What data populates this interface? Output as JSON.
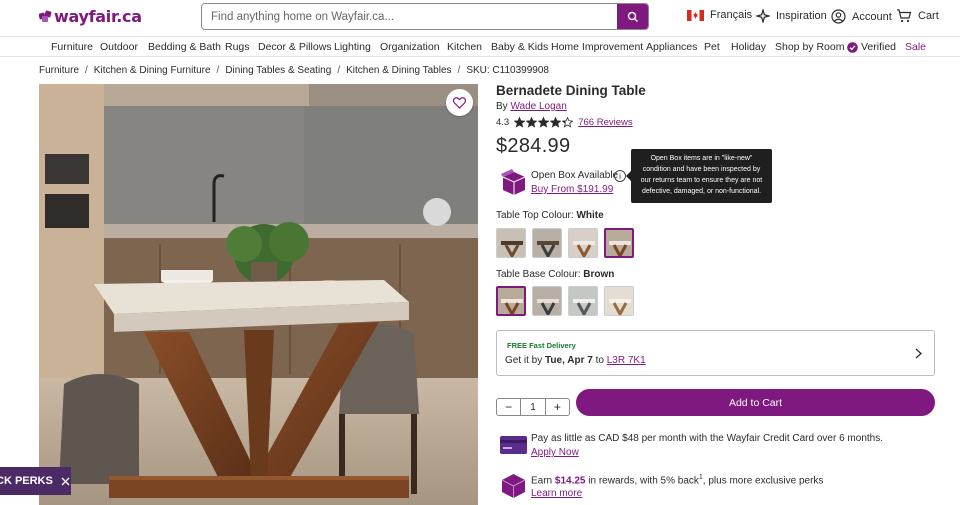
{
  "brand": {
    "logo_text": "wayfair.ca",
    "accent": "#7f187f"
  },
  "search": {
    "placeholder": "Find anything home on Wayfair.ca..."
  },
  "header_links": {
    "language": "Français",
    "inspiration": "Inspiration",
    "account": "Account",
    "cart": "Cart"
  },
  "nav": {
    "items": [
      "Furniture",
      "Outdoor",
      "Bedding & Bath",
      "Rugs",
      "Decor & Pillows",
      "Lighting",
      "Organization",
      "Kitchen",
      "Baby & Kids",
      "Home Improvement",
      "Appliances",
      "Pet",
      "Holiday",
      "Shop by Room",
      "Verified",
      "Sale"
    ]
  },
  "breadcrumb": {
    "items": [
      "Furniture",
      "Kitchen & Dining Furniture",
      "Dining Tables & Seating",
      "Kitchen & Dining Tables"
    ],
    "sku": "SKU: C110399908"
  },
  "perks": {
    "label": "CK PERKS"
  },
  "product": {
    "title": "Bernadete Dining Table",
    "by_prefix": "By",
    "brand": "Wade Logan",
    "rating": "4.3",
    "rating_stars": 4.3,
    "reviews": "766 Reviews",
    "price": "$284.99"
  },
  "open_box": {
    "label": "Open Box Available",
    "link": "Buy From $191.99",
    "tooltip": [
      "Open Box items are in \"like-new\"",
      "condition and have been inspected by",
      "our returns team to ensure they are not",
      "defective, damaged, or non-functional."
    ]
  },
  "options": {
    "top": {
      "label": "Table Top Colour:",
      "value": "White"
    },
    "base": {
      "label": "Table Base Colour:",
      "value": "Brown"
    }
  },
  "delivery": {
    "free": "FREE Fast Delivery",
    "prefix": "Get it by",
    "date": "Tue, Apr 7",
    "to": "to",
    "postal": "L3R 7K1"
  },
  "cart": {
    "quantity": "1",
    "minus": "−",
    "plus": "+",
    "add_label": "Add to Cart"
  },
  "credit": {
    "text": "Pay as little as CAD $48 per month with the Wayfair Credit Card over 6 months.",
    "link": "Apply Now"
  },
  "rewards": {
    "prefix": "Earn",
    "amount": "$14.25",
    "suffix": "in rewards, with 5% back",
    "sup": "1",
    "tail": ", plus more exclusive perks",
    "link": "Learn more"
  }
}
